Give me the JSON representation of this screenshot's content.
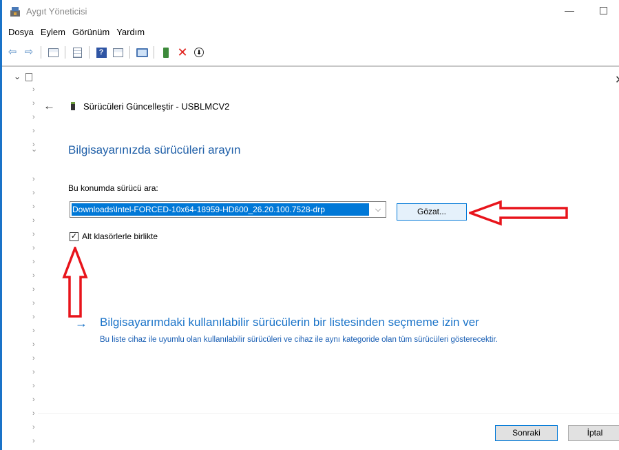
{
  "window": {
    "title": "Aygıt Yöneticisi",
    "minimize_glyph": "—"
  },
  "menu": {
    "items": [
      "Dosya",
      "Eylem",
      "Görünüm",
      "Yardım"
    ]
  },
  "toolbar": {
    "icons": [
      "back-arrow-icon",
      "forward-arrow-icon",
      "properties-icon",
      "document-icon",
      "help-icon",
      "view-icon",
      "monitor-icon",
      "update-driver-icon",
      "remove-icon",
      "download-icon"
    ],
    "back_glyph": "⇦",
    "forward_glyph": "⇨",
    "help_glyph": "?",
    "remove_glyph": "✕",
    "download_glyph": "⬇"
  },
  "tree": {
    "expand_glyph": "⌄",
    "chevron_glyph": "›"
  },
  "dialog": {
    "close_glyph": "✕",
    "back_glyph": "←",
    "title": "Sürücüleri Güncelleştir - USBLMCV2",
    "heading": "Bilgisayarınızda sürücüleri arayın",
    "location_label": "Bu konumda sürücü ara:",
    "path_value": "Downloads\\Intel-FORCED-10x64-18959-HD600_26.20.100.7528-drp",
    "combo_chevron": "⌵",
    "browse_label": "Gözat...",
    "subfolders_checked": true,
    "check_glyph": "✓",
    "subfolders_label": "Alt klasörlerle birlikte",
    "link_arrow": "→",
    "link_title": "Bilgisayarımdaki kullanılabilir sürücülerin bir listesinden seçmeme izin ver",
    "link_description": "Bu liste cihaz ile uyumlu olan kullanılabilir sürücüleri ve cihaz ile aynı kategoride olan tüm sürücüleri gösterecektir.",
    "next_label": "Sonraki",
    "cancel_label": "İptal"
  },
  "colors": {
    "accent": "#0078d7",
    "link": "#1a73c8",
    "annotation": "#e8141b"
  }
}
